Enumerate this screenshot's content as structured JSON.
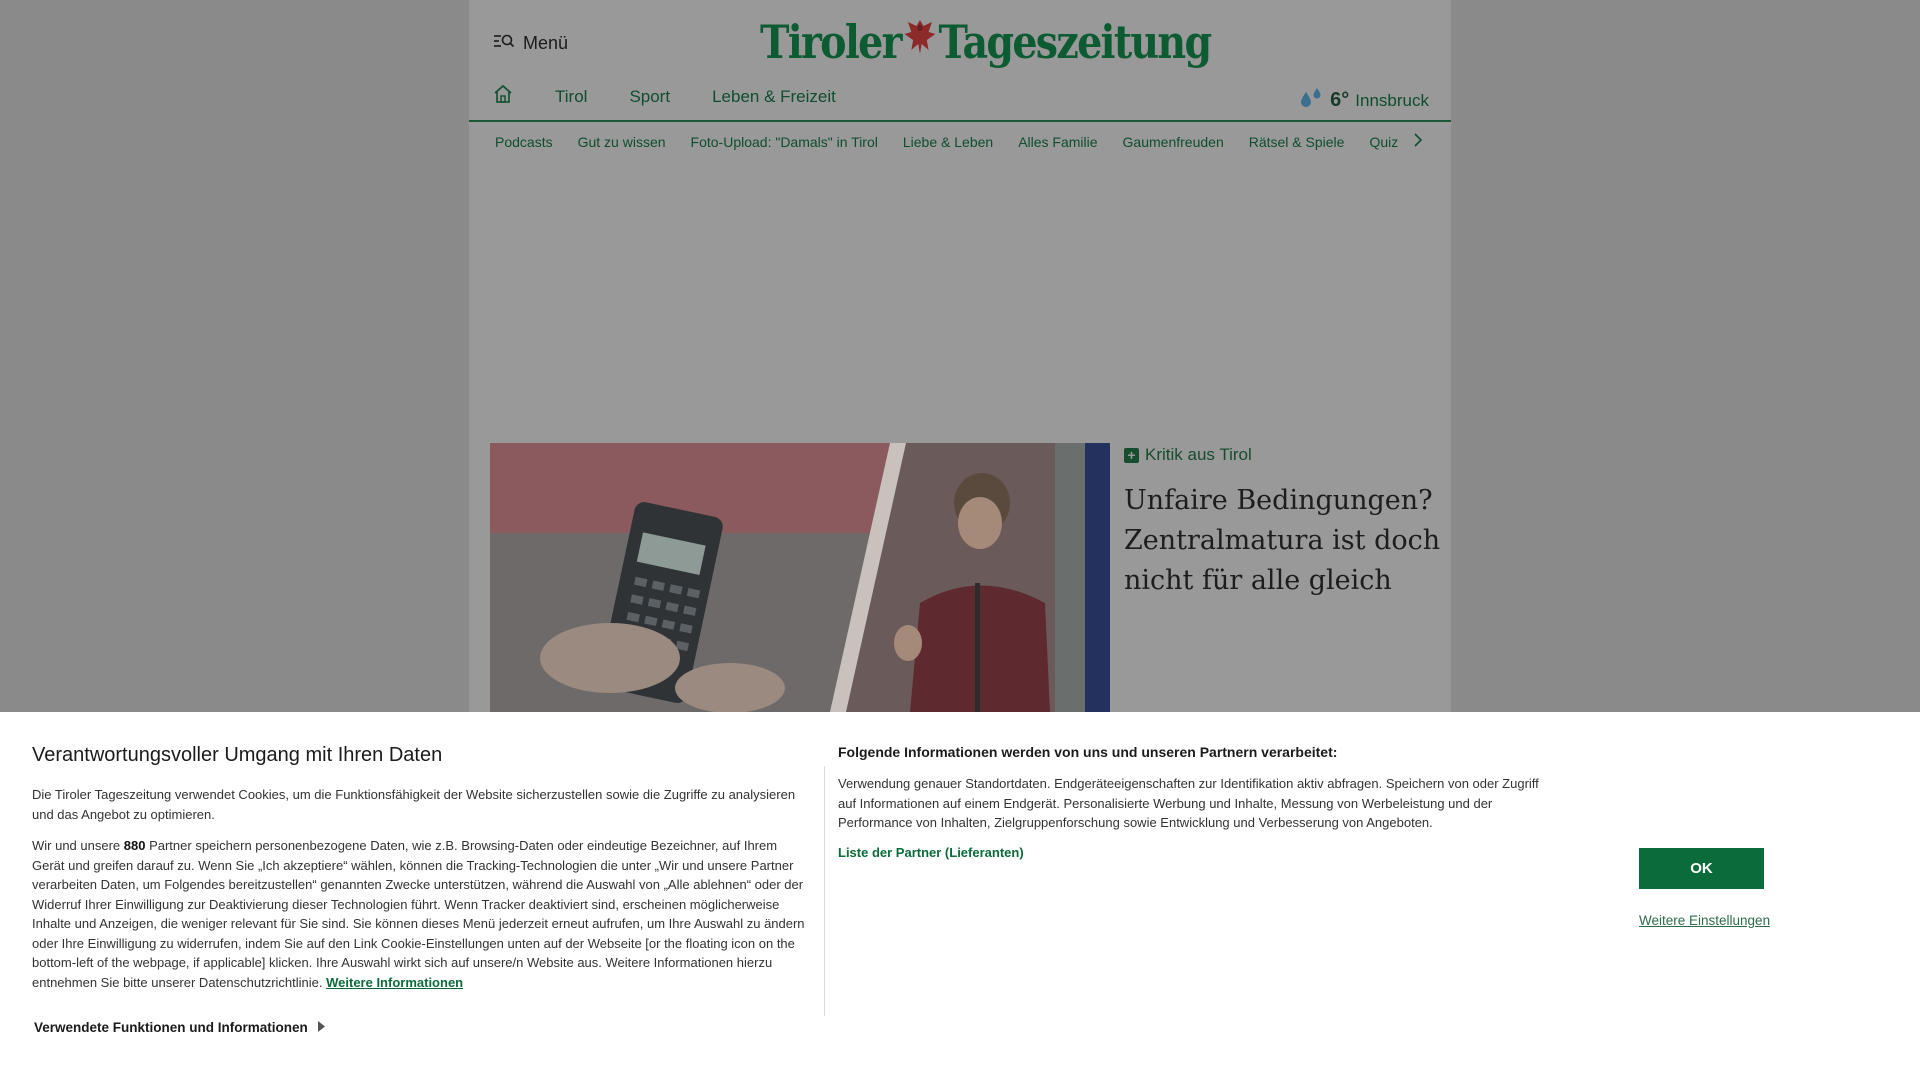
{
  "header": {
    "menu_label": "Menü",
    "logo_left": "Tiroler",
    "logo_right": "Tageszeitung"
  },
  "nav_primary": [
    "Tirol",
    "Sport",
    "Leben & Freizeit"
  ],
  "weather": {
    "temperature": "6°",
    "location": "Innsbruck"
  },
  "nav_secondary": [
    "Podcasts",
    "Gut zu wissen",
    "Foto-Upload: \"Damals\" in Tirol",
    "Liebe & Leben",
    "Alles Familie",
    "Gaumenfreuden",
    "Rätsel & Spiele",
    "Quiz"
  ],
  "teaser": {
    "kicker": "Kritik aus Tirol",
    "headline": "Unfaire Bedingungen? Zentralmatura ist doch nicht für alle gleich"
  },
  "consent": {
    "title": "Verantwortungsvoller Umgang mit Ihren Daten",
    "intro": "Die Tiroler Tageszeitung verwendet Cookies, um die Funktionsfähigkeit der Website sicherzustellen sowie die Zugriffe zu analysieren und das Angebot zu optimieren.",
    "partners_pre": "Wir und unsere ",
    "partners_count": "880",
    "partners_body": " Partner speichern personenbezogene Daten, wie z.B. Browsing-Daten oder eindeutige Bezeichner, auf Ihrem Gerät und greifen darauf zu. Wenn Sie „Ich akzeptiere“ wählen, können die Tracking-Technologien die unter „Wir und unsere Partner verarbeiten Daten, um Folgendes bereitzustellen“ genannten Zwecke unterstützen, während die Auswahl von „Alle ablehnen“ oder der Widerruf Ihrer Einwilligung zur Deaktivierung dieser Technologien führt. Wenn Tracker deaktiviert sind, erscheinen möglicherweise Inhalte und Anzeigen, die weniger relevant für Sie sind. Sie können dieses Menü jederzeit erneut aufrufen, um Ihre Auswahl zu ändern oder Ihre Einwilligung zu widerrufen, indem Sie auf den Link Cookie-Einstellungen unten auf der Webseite [or the floating icon on the bottom-left of the webpage, if applicable] klicken. Ihre Auswahl wirkt sich auf unsere/n Website aus. Weitere Informationen hierzu entnehmen Sie bitte unserer Datenschutzrichtlinie. ",
    "more_info_link": "Weitere Informationen",
    "functions_toggle": "Verwendete Funktionen und Informationen",
    "mid_heading": "Folgende Informationen werden von uns und unseren Partnern verarbeitet:",
    "mid_body": "Verwendung genauer Standortdaten. Endgeräteeigenschaften zur Identifikation aktiv abfragen. Speichern von oder Zugriff auf Informationen auf einem Endgerät. Personalisierte Werbung und Inhalte, Messung von Werbeleistung und der Performance von Inhalten, Zielgruppenforschung sowie Entwicklung und Verbesserung von Angeboten.",
    "partners_list_link": "Liste der Partner (Lieferanten)",
    "ok_label": "OK",
    "more_settings_label": "Weitere Einstellungen"
  },
  "colors": {
    "brand_green": "#0d5b32",
    "button_green": "#0b6b3a",
    "overlay_gray": "#8a8a8a"
  }
}
